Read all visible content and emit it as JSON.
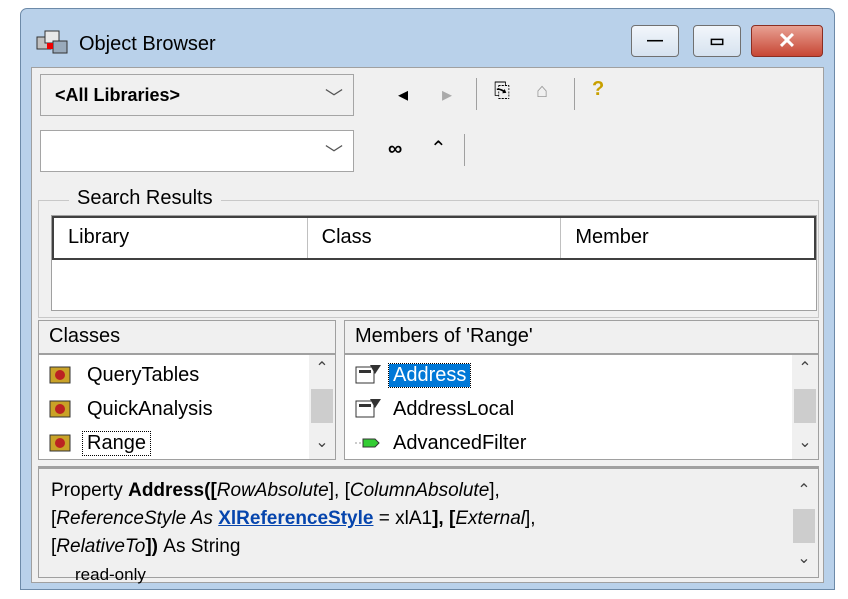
{
  "window": {
    "title": "Object Browser"
  },
  "toolbar": {
    "library_combo_value": "<All Libraries>",
    "search_combo_value": ""
  },
  "search_results": {
    "group_label": "Search Results",
    "columns": [
      "Library",
      "Class",
      "Member"
    ]
  },
  "classes": {
    "header": "Classes",
    "items": [
      "QueryTables",
      "QuickAnalysis",
      "Range"
    ]
  },
  "members": {
    "header": "Members of 'Range'",
    "items": [
      "Address",
      "AddressLocal",
      "AdvancedFilter"
    ]
  },
  "details": {
    "prefix": "Property ",
    "member_name": "Address",
    "open_paren": "([",
    "p1": "RowAbsolute",
    "s1": "], [",
    "p2": "ColumnAbsolute",
    "s2": "],",
    "s3": "[",
    "p3": "ReferenceStyle As ",
    "link": "XlReferenceStyle",
    "s4": " = xlA1",
    "s5": "], [",
    "p4": "External",
    "s6": "],",
    "s7": "[",
    "p5": "RelativeTo",
    "s8": "]) ",
    "returns": "As String",
    "readonly": "read-only"
  },
  "colors": {
    "selection": "#0078d7",
    "link": "#0645ad",
    "frame": "#b9d1ea"
  }
}
